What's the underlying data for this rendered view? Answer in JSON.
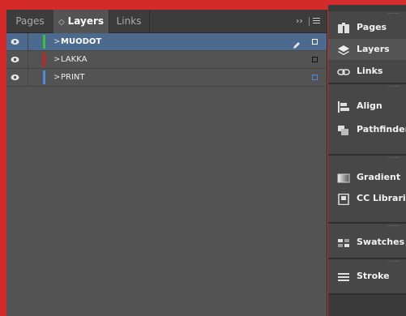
{
  "tabs": [
    {
      "label": "Pages",
      "active": false
    },
    {
      "label": "Layers",
      "active": true
    },
    {
      "label": "Links",
      "active": false
    }
  ],
  "panel_menu": {
    "collapse_glyph": "››"
  },
  "layers": [
    {
      "name": "MUODOT",
      "color": "#38c13a",
      "selected": true,
      "square_color": "#ffffff"
    },
    {
      "name": "LAKKA",
      "color": "#cf1f1f",
      "selected": false,
      "square_color": "#111111"
    },
    {
      "name": "PRINT",
      "color": "#4d8ce0",
      "selected": false,
      "square_color": "#4d8ce0"
    }
  ],
  "side_panels": {
    "group1": [
      {
        "label": "Pages",
        "icon": "pages-icon"
      },
      {
        "label": "Layers",
        "icon": "layers-icon",
        "active": true
      },
      {
        "label": "Links",
        "icon": "links-icon"
      }
    ],
    "group2": [
      {
        "label": "Align",
        "icon": "align-icon"
      },
      {
        "label": "Pathfinder",
        "icon": "pathfinder-icon"
      }
    ],
    "group3": [
      {
        "label": "Gradient",
        "icon": "gradient-icon"
      },
      {
        "label": "CC Libraries",
        "icon": "cc-libraries-icon"
      }
    ],
    "group4": [
      {
        "label": "Swatches",
        "icon": "swatches-icon"
      }
    ],
    "group5": [
      {
        "label": "Stroke",
        "icon": "stroke-icon"
      }
    ]
  },
  "colors": {
    "frame": "#d42a2a",
    "panel": "#535353",
    "selected_row": "#4b6a8e"
  }
}
